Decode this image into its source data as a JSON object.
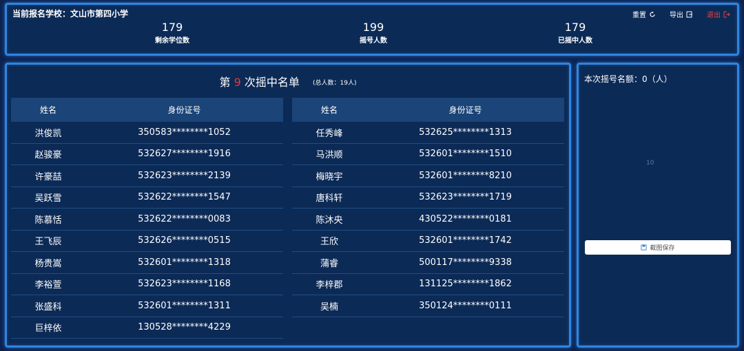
{
  "header": {
    "school_label": "当前报名学校：文山市第四小学",
    "actions": {
      "reset": "重置",
      "export": "导出",
      "logout": "退出"
    },
    "stats": [
      {
        "value": "179",
        "label": "剩余学位数"
      },
      {
        "value": "199",
        "label": "摇号人数"
      },
      {
        "value": "179",
        "label": "已摇中人数"
      }
    ]
  },
  "draw_list": {
    "title_prefix": "第",
    "round": "9",
    "title_suffix": "次摇中名单",
    "total": "(总人数：19人)",
    "columns": {
      "name": "姓名",
      "id": "身份证号"
    },
    "left_rows": [
      {
        "name": "洪俊凯",
        "id": "350583********1052"
      },
      {
        "name": "赵骏豪",
        "id": "532627********1916"
      },
      {
        "name": "许豪喆",
        "id": "532623********2139"
      },
      {
        "name": "吴跃雪",
        "id": "532622********1547"
      },
      {
        "name": "陈慕恬",
        "id": "532622********0083"
      },
      {
        "name": "王飞辰",
        "id": "532626********0515"
      },
      {
        "name": "杨贵嵩",
        "id": "532601********1318"
      },
      {
        "name": "李裕萱",
        "id": "532623********1168"
      },
      {
        "name": "张盛科",
        "id": "532601********1311"
      },
      {
        "name": "巨梓依",
        "id": "130528********4229"
      }
    ],
    "right_rows": [
      {
        "name": "任秀峰",
        "id": "532625********1313"
      },
      {
        "name": "马洪顺",
        "id": "532601********1510"
      },
      {
        "name": "梅晓宇",
        "id": "532601********8210"
      },
      {
        "name": "唐科轩",
        "id": "532623********1719"
      },
      {
        "name": "陈沐央",
        "id": "430522********0181"
      },
      {
        "name": "王欣",
        "id": "532601********1742"
      },
      {
        "name": "蒲睿",
        "id": "500117********9338"
      },
      {
        "name": "李梓郡",
        "id": "131125********1862"
      },
      {
        "name": "吴楠",
        "id": "350124********0111"
      }
    ]
  },
  "side": {
    "title": "本次摇号名额：0（人）",
    "placeholder": "10",
    "save_label": "截图保存"
  }
}
